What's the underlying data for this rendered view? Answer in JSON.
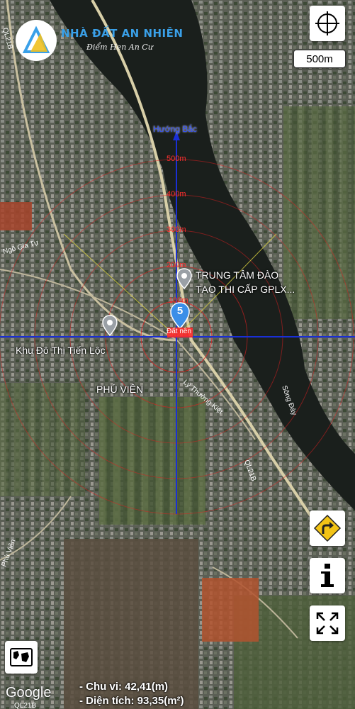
{
  "logo": {
    "title": "NHÀ ĐẤT AN NHIÊN",
    "subtitle": "Điểm Hẹn An Cư"
  },
  "scale": {
    "label": "500m"
  },
  "north_label": "Hướng Bắc",
  "rings": [
    "500m",
    "400m",
    "300m",
    "200m",
    "100m"
  ],
  "center_marker": {
    "number": "5",
    "tag": "Đất nền"
  },
  "places": {
    "training_center": "TRUNG TÂM ĐÀO\nTẠO THI CẤP GPLX...",
    "urban_area": "Khu Đô Thị Tiến Lộc",
    "ward": "PHÚ VIÊN"
  },
  "roads": {
    "ngo_gia_tu": "Ngô Gia Tự",
    "ly_thuong_kiet": "Lý Thường Kiệt",
    "ql21b": "QL21B",
    "ql21b_top": "QL21B",
    "song_day": "Sông Đáy",
    "phu_vien": "Phù Viên",
    "ql21b_bottom": "QL21B"
  },
  "stats": {
    "perimeter": "- Chu vi: 42,41(m)",
    "area": "- Diện tích: 93,35(m²)"
  },
  "attribution": "Google",
  "colors": {
    "accent": "#3aa0e8",
    "crosshair": "#1a2fd6",
    "ring": "#e02020"
  }
}
